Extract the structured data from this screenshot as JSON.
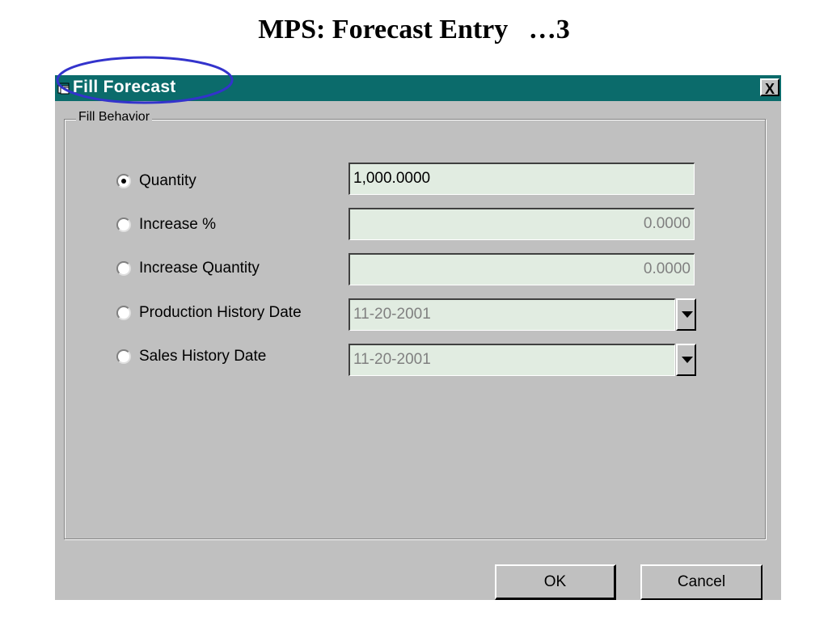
{
  "slide": {
    "title": "MPS: Forecast Entry   …3"
  },
  "window": {
    "title": "Fill Forecast",
    "close_label": "X",
    "accent_color": "#0b6b6b",
    "highlight_color": "#3333cc"
  },
  "group": {
    "label": "Fill Behavior"
  },
  "options": [
    {
      "label": "Quantity",
      "checked": true,
      "value": "1,000.0000"
    },
    {
      "label": "Increase %",
      "checked": false,
      "value": "0.0000"
    },
    {
      "label": "Increase Quantity",
      "checked": false,
      "value": "0.0000"
    },
    {
      "label": "Production History Date",
      "checked": false,
      "value": "11-20-2001"
    },
    {
      "label": "Sales History Date",
      "checked": false,
      "value": "11-20-2001"
    }
  ],
  "buttons": {
    "ok": "OK",
    "cancel": "Cancel"
  },
  "field_color": "#e1ece1"
}
